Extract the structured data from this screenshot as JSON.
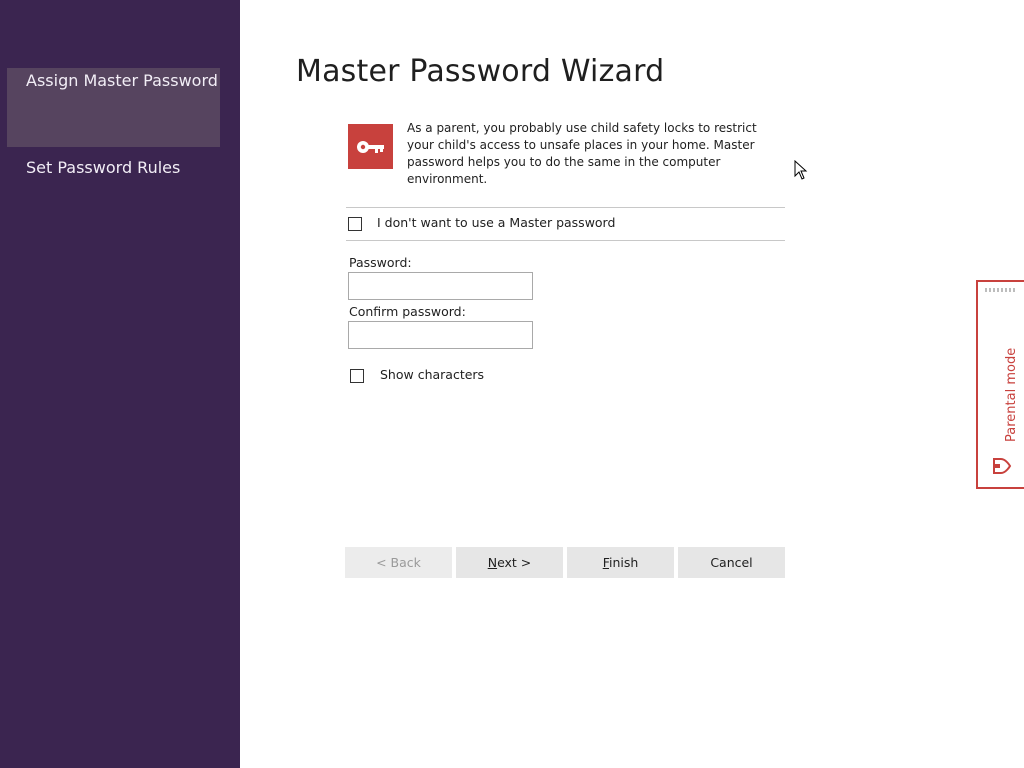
{
  "sidebar": {
    "items": [
      {
        "label": "Assign Master Password",
        "active": true
      },
      {
        "label": "Set Password Rules",
        "active": false
      }
    ]
  },
  "wizard": {
    "title": "Master Password Wizard",
    "intro": "As a parent, you probably use child safety locks to restrict your child's access to unsafe places in your home. Master password helps you to do the same in the computer environment.",
    "no_password_label": "I don't want to use a Master password",
    "password_label": "Password:",
    "password_value": "",
    "confirm_label": "Confirm password:",
    "confirm_value": "",
    "show_chars_label": "Show characters",
    "buttons": {
      "back": "< Back",
      "next_mnemonic": "N",
      "next_rest": "ext >",
      "finish_mnemonic": "F",
      "finish_rest": "inish",
      "cancel": "Cancel"
    }
  },
  "parental_mode": {
    "label": "Parental mode",
    "icon": "shield-icon"
  },
  "colors": {
    "sidebar_bg": "#3b2550",
    "sidebar_active": "#56445f",
    "accent": "#c8413d",
    "button_bg": "#e6e6e6"
  }
}
